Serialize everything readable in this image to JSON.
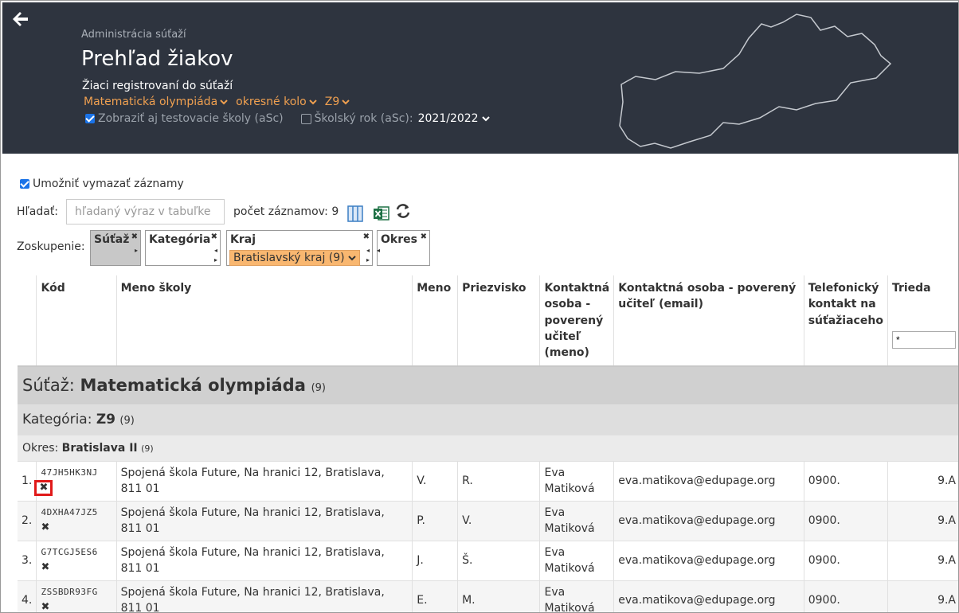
{
  "header": {
    "breadcrumb": "Administrácia súťaží",
    "title": "Prehľad žiakov",
    "subtitle": "Žiaci registrovaní do súťaží",
    "filters": [
      "Matematická olympiáda",
      "okresné kolo",
      "Z9"
    ],
    "show_test_schools": "Zobraziť aj testovacie školy (aSc)",
    "school_year_label": "Školský rok (aSc):",
    "school_year": "2021/2022",
    "colors": {
      "bg": "#2e343f",
      "accent": "#f0a050"
    }
  },
  "toolbar": {
    "allow_delete": "Umožniť vymazať záznamy",
    "search_label": "Hľadať:",
    "search_placeholder": "hľadaný výraz v tabuľke",
    "record_count": "počet záznamov: 9",
    "icons": [
      "columns-icon",
      "excel-icon",
      "refresh-icon"
    ]
  },
  "grouping": {
    "label": "Zoskupenie:",
    "chips": [
      "Súťaž",
      "Kategória",
      "Kraj",
      "Okres"
    ],
    "kraj_value": "Bratislavský kraj (9)"
  },
  "table": {
    "headers": {
      "code": "Kód",
      "school": "Meno školy",
      "first": "Meno",
      "last": "Priezvisko",
      "contact_name": "Kontaktná osoba - poverený učiteľ (meno)",
      "contact_email": "Kontaktná osoba - poverený učiteľ (email)",
      "phone": "Telefonický kontakt na súťažiaceho",
      "class": "Trieda"
    },
    "class_filter_value": "*",
    "groups": {
      "competition_label": "Súťaž:",
      "competition": "Matematická olympiáda",
      "competition_count": "(9)",
      "category_label": "Kategória:",
      "category": "Z9",
      "category_count": "(9)",
      "district_label": "Okres:",
      "district": "Bratislava II",
      "district_count": "(9)"
    },
    "rows": [
      {
        "num": "1.",
        "code": "47JH5HK3NJ",
        "school": "Spojená škola Future, Na hranici 12, Bratislava, 811 01",
        "first": "V.",
        "last": "R.",
        "contact": "Eva Matiková",
        "email": "eva.matikova@edupage.org",
        "phone": "0900.",
        "class": "9.A"
      },
      {
        "num": "2.",
        "code": "4DXHA47JZ5",
        "school": "Spojená škola Future, Na hranici 12, Bratislava, 811 01",
        "first": "P.",
        "last": "V.",
        "contact": "Eva Matiková",
        "email": "eva.matikova@edupage.org",
        "phone": "0900.",
        "class": "9.A"
      },
      {
        "num": "3.",
        "code": "G7TCGJ5ES6",
        "school": "Spojená škola Future, Na hranici 12, Bratislava, 811 01",
        "first": "J.",
        "last": "Š.",
        "contact": "Eva Matiková",
        "email": "eva.matikova@edupage.org",
        "phone": "0900.",
        "class": "9.A"
      },
      {
        "num": "4.",
        "code": "ZSSBDR93FG",
        "school": "Spojená škola Future, Na hranici 12, Bratislava, 811 01",
        "first": "E.",
        "last": "M.",
        "contact": "Eva Matiková",
        "email": "eva.matikova@edupage.org",
        "phone": "0900.",
        "class": "9.A"
      }
    ]
  }
}
